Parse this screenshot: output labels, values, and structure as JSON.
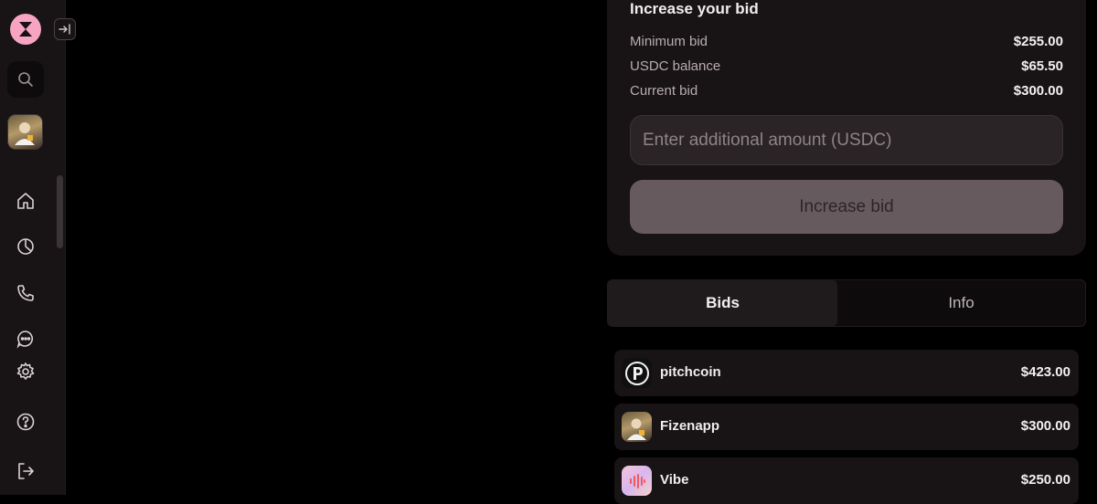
{
  "sidebar": {
    "nav": [
      {
        "icon": "home-icon"
      },
      {
        "icon": "pie-chart-icon"
      },
      {
        "icon": "phone-icon"
      },
      {
        "icon": "chat-icon"
      },
      {
        "icon": "settings-icon"
      },
      {
        "icon": "help-icon"
      },
      {
        "icon": "logout-icon"
      }
    ]
  },
  "bid_panel": {
    "title": "Increase your bid",
    "rows": [
      {
        "label": "Minimum bid",
        "value": "$255.00"
      },
      {
        "label": "USDC balance",
        "value": "$65.50"
      },
      {
        "label": "Current bid",
        "value": "$300.00"
      }
    ],
    "input_placeholder": "Enter additional amount (USDC)",
    "button_label": "Increase bid"
  },
  "tabs": [
    {
      "label": "Bids",
      "active": true
    },
    {
      "label": "Info",
      "active": false
    }
  ],
  "bids": [
    {
      "name": "pitchcoin",
      "amount": "$423.00",
      "avatar": "pitchcoin-logo"
    },
    {
      "name": "Fizenapp",
      "amount": "$300.00",
      "avatar": "user-photo"
    },
    {
      "name": "Vibe",
      "amount": "$250.00",
      "avatar": "vibe-logo"
    }
  ],
  "colors": {
    "background": "#000000",
    "panel": "#181314",
    "logo_pink": "#f6a4c2",
    "button_disabled": "#675a5f"
  }
}
